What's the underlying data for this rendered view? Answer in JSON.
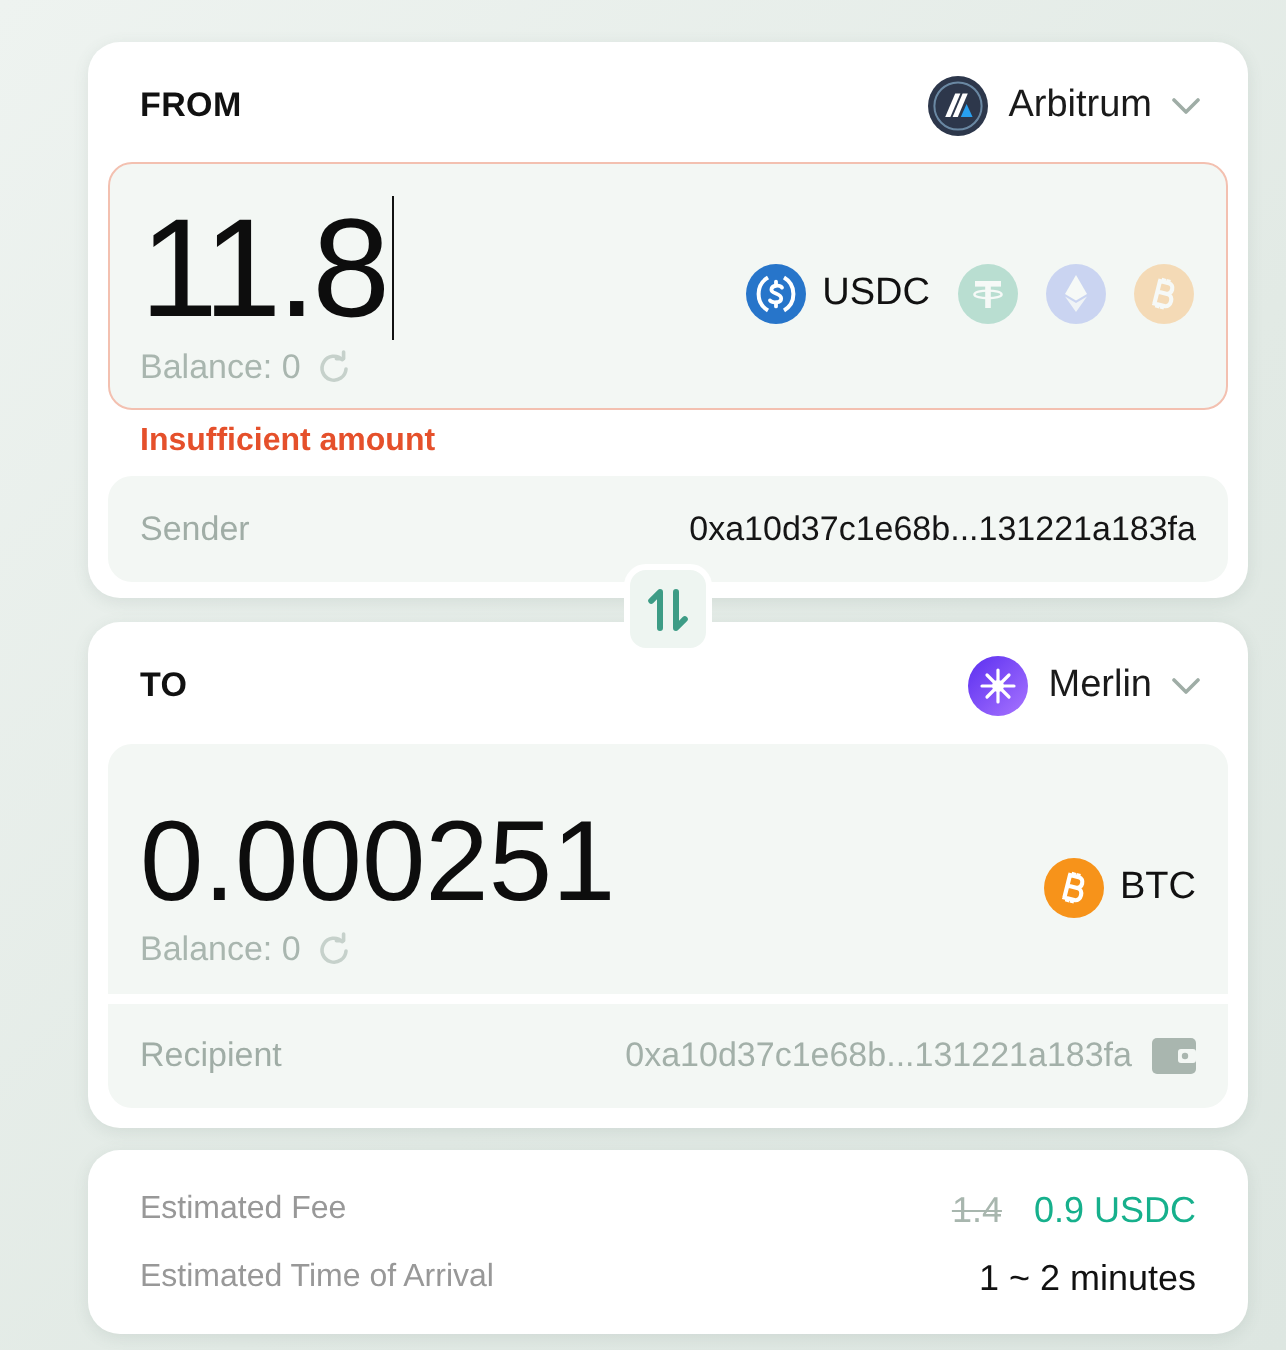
{
  "from": {
    "heading": "FROM",
    "chain": {
      "kind": "arbitrum",
      "label": "Arbitrum"
    },
    "amount": {
      "value": "11.8",
      "focused": true
    },
    "balance": "Balance: 0",
    "tokens": [
      {
        "kind": "usdc",
        "label": "USDC",
        "selected": true
      },
      {
        "kind": "usdt",
        "selected": false
      },
      {
        "kind": "eth",
        "selected": false
      },
      {
        "kind": "btc",
        "selected": false
      }
    ],
    "error": "Insufficient amount",
    "sender": {
      "label": "Sender",
      "value": "0xa10d37c1e68b...131221a183fa"
    }
  },
  "to": {
    "heading": "TO",
    "chain": {
      "kind": "merlin",
      "label": "Merlin"
    },
    "amount": "0.000251",
    "balance": "Balance: 0",
    "token": {
      "kind": "btc",
      "label": "BTC"
    },
    "recipient": {
      "label": "Recipient",
      "value": "0xa10d37c1e68b...131221a183fa"
    }
  },
  "fee": {
    "label": "Estimated Fee",
    "original": "1.4",
    "value": "0.9 USDC"
  },
  "eta": {
    "label": "Estimated Time of Arrival",
    "value": "1 ~ 2 minutes"
  }
}
